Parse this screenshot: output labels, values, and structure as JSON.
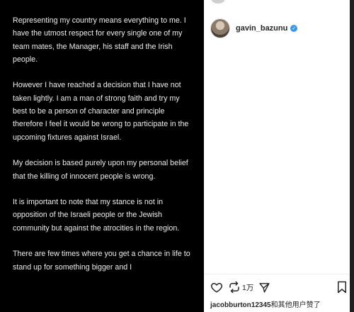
{
  "post": {
    "paragraphs": [
      "Representing my country means everything to me. I have the utmost respect for every single one of my team mates, the Manager, his staff and the Irish people.",
      "However I have reached a decision that I have not taken lightly. I am a man of strong faith and try my best to be a person of character and principle therefore I feel it would be wrong to participate in the upcoming fixtures against Israel.",
      "My decision is based purely upon my personal belief that the killing of innocent people is wrong.",
      "It is important to note that my stance is not in opposition of the Israeli people or the Jewish community but against the atrocities in the region.",
      "There are few times where you get a chance in life to stand up for something bigger and I"
    ]
  },
  "sidebar": {
    "username": "gavin_bazunu",
    "verified_mark": "✓",
    "share_count": "1万",
    "liked_by_user": "jacobburton12345",
    "liked_by_suffix": "和其他用户赞了"
  },
  "icons": [
    "heart-icon",
    "share-icon",
    "send-icon",
    "bookmark-icon",
    "verified-badge-icon"
  ],
  "colors": {
    "verified_blue": "#3897f0",
    "post_background": "#000000",
    "text_dark": "#262626"
  }
}
